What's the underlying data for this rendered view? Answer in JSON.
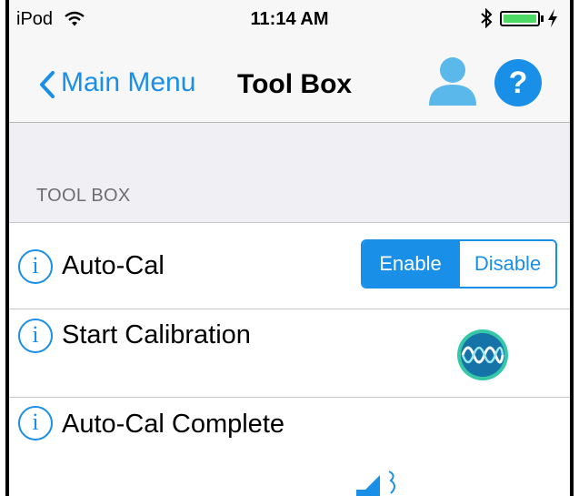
{
  "status_bar": {
    "device": "iPod",
    "time": "11:14 AM",
    "wifi_icon": "wifi-icon",
    "bluetooth_icon": "bluetooth-icon",
    "battery_icon": "battery-icon",
    "charging_icon": "charging-bolt-icon",
    "battery_color": "#4cd964"
  },
  "nav": {
    "back_label": "Main Menu",
    "title": "Tool Box",
    "user_icon": "user-icon",
    "help_icon": "help-icon",
    "help_glyph": "?"
  },
  "section": {
    "header": "TOOL BOX"
  },
  "rows": [
    {
      "label": "Auto-Cal",
      "info_icon": "info-icon",
      "info_glyph": "i",
      "control": {
        "type": "segmented",
        "options": [
          "Enable",
          "Disable"
        ],
        "selected": "Enable"
      }
    },
    {
      "label": "Start Calibration",
      "info_icon": "info-icon",
      "info_glyph": "i",
      "action_icon": "calibration-wave-icon"
    },
    {
      "label": "Auto-Cal Complete",
      "info_icon": "info-icon",
      "info_glyph": "i",
      "status_icon": "speaker-sound-icon"
    }
  ],
  "colors": {
    "accent": "#1a8fe8",
    "navbar_bg": "#f7f7f7",
    "group_bg": "#efeff4",
    "user_icon": "#5ab8ea",
    "wave_ring": "#35c7a6",
    "wave_bg": "#1573a8"
  }
}
